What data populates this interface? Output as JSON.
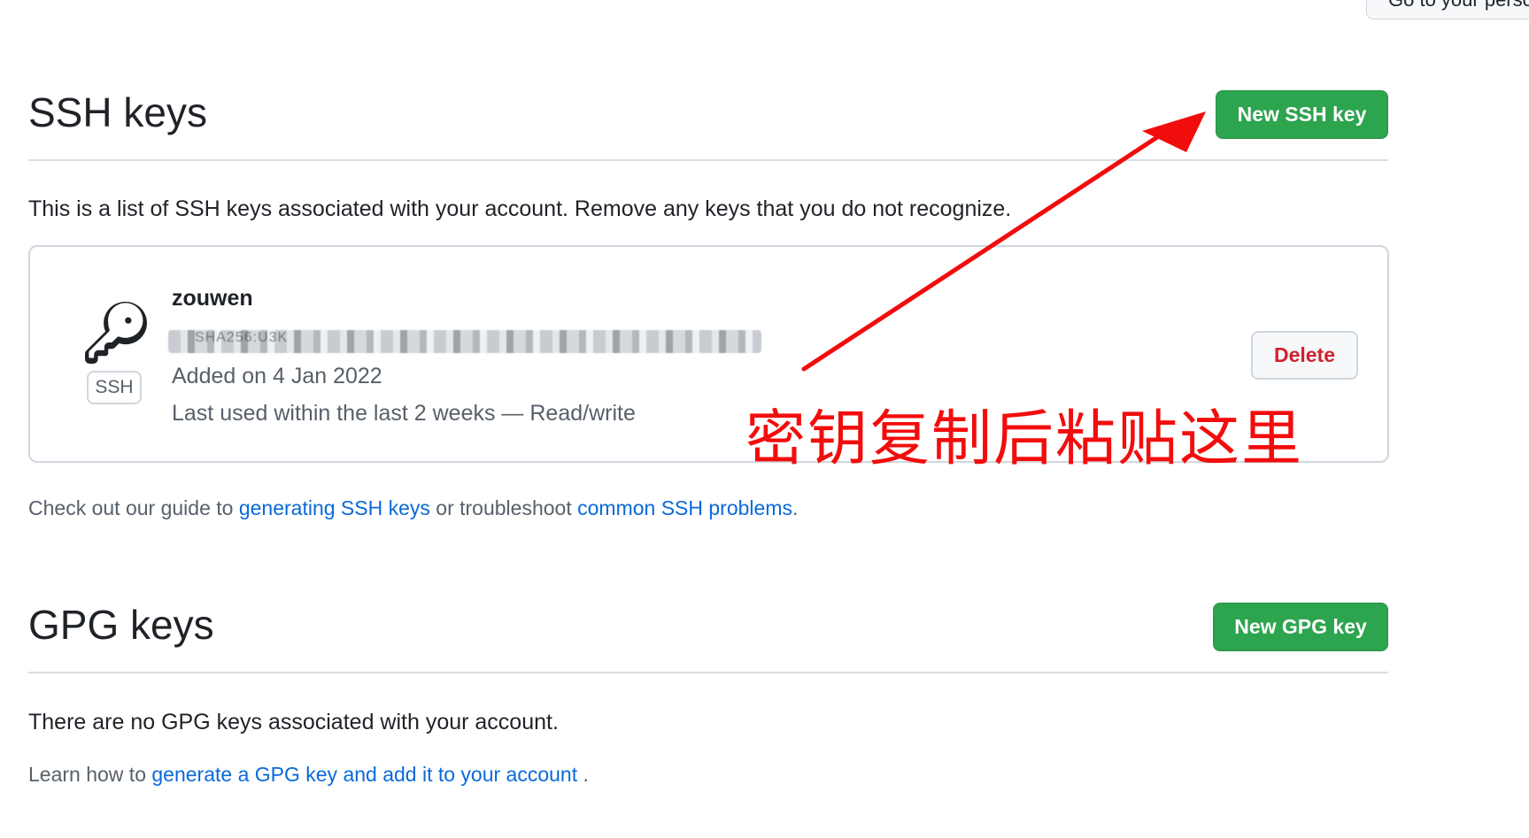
{
  "top": {
    "button_label": "Go to your personal profile"
  },
  "ssh": {
    "title": "SSH keys",
    "new_button": "New SSH key",
    "description": "This is a list of SSH keys associated with your account. Remove any keys that you do not recognize.",
    "keys": [
      {
        "title": "zouwen",
        "badge": "SSH",
        "fingerprint_visible": "SHA256:U3K",
        "added": "Added on 4 Jan 2022",
        "last_used": "Last used within the last 2 weeks — Read/write",
        "delete_label": "Delete"
      }
    ],
    "guide": {
      "prefix": "Check out our guide to ",
      "link1": "generating SSH keys",
      "middle": " or troubleshoot ",
      "link2": "common SSH problems",
      "suffix": "."
    }
  },
  "gpg": {
    "title": "GPG keys",
    "new_button": "New GPG key",
    "empty_text": "There are no GPG keys associated with your account.",
    "learn": {
      "prefix": "Learn how to ",
      "link": "generate a GPG key and add it to your account",
      "suffix": " ."
    }
  },
  "annotation": {
    "text": "密钥复制后粘贴这里",
    "color": "#f20d0d"
  },
  "colors": {
    "primary_green": "#2da44e",
    "link_blue": "#0969da",
    "danger_red": "#cf222e",
    "border": "#d0d7de"
  }
}
